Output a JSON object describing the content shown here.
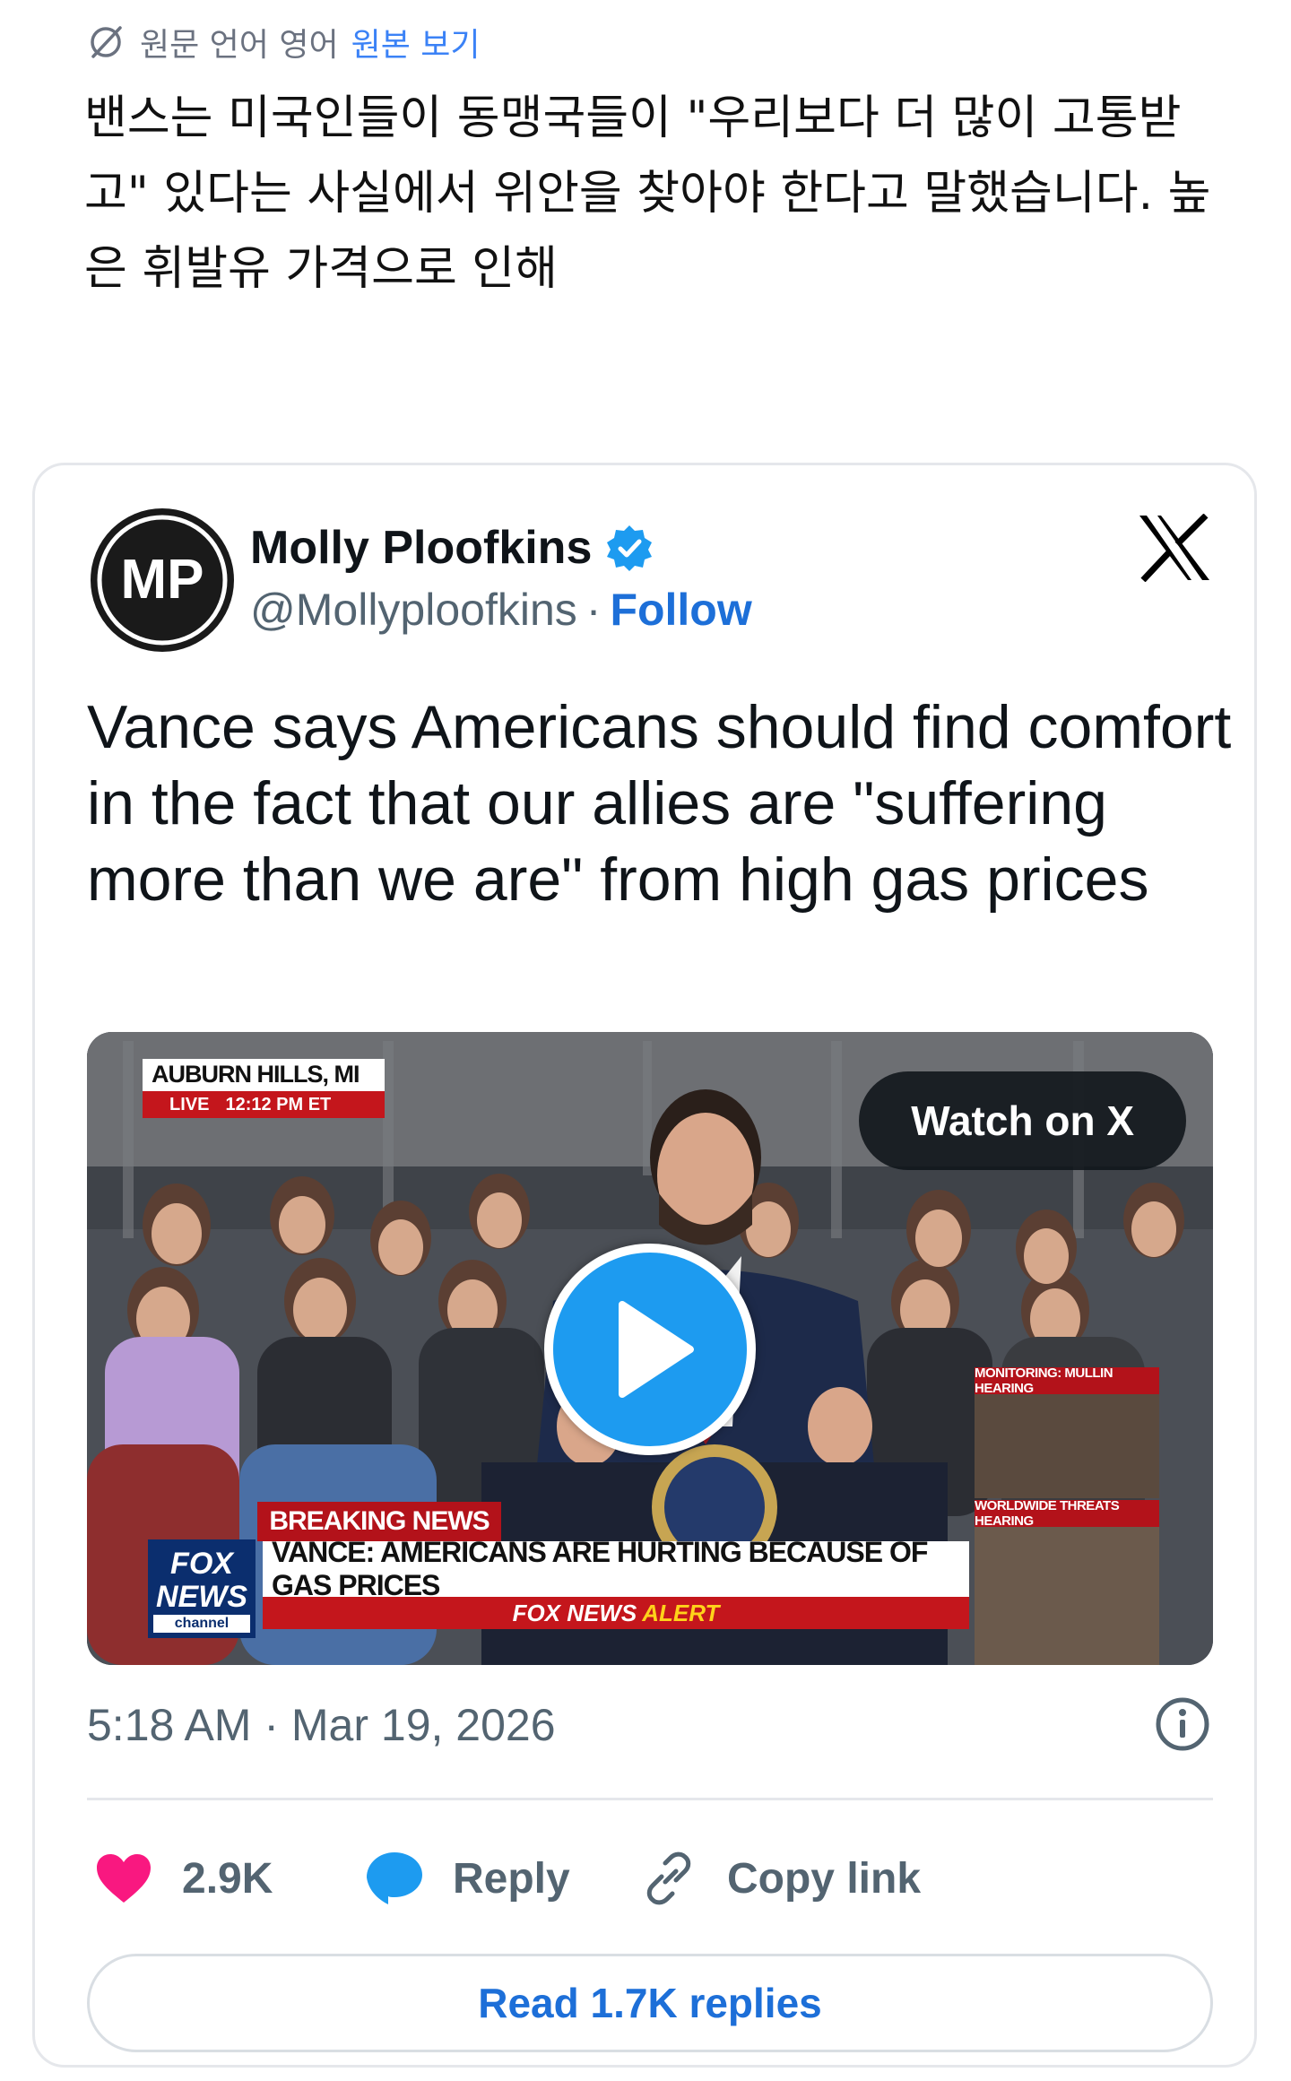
{
  "translation": {
    "source_language_label": "원문 언어 영어",
    "view_original_label": "원본 보기",
    "text": "밴스는 미국인들이 동맹국들이 \"우리보다 더 많이 고통받고\" 있다는 사실에서 위안을 찾아야 한다고 말했습니다. 높은 휘발유 가격으로 인해"
  },
  "tweet": {
    "author_name": "Molly Ploofkins",
    "avatar_initials": "MP",
    "handle": "@Mollyploofkins",
    "separator": "·",
    "follow_label": "Follow",
    "text": "Vance says Americans should find comfort in the fact that our allies are \"suffering more than we are\" from high gas prices",
    "timestamp": "5:18 AM · Mar 19, 2026",
    "likes": "2.9K",
    "reply_label": "Reply",
    "copy_link_label": "Copy link",
    "read_replies_label": "Read 1.7K replies"
  },
  "video": {
    "watch_label": "Watch on X",
    "location": "AUBURN HILLS, MI",
    "live_label": "LIVE",
    "live_time": "12:12 PM ET",
    "breaking_label": "BREAKING NEWS",
    "headline": "VANCE: AMERICANS ARE HURTING BECAUSE OF GAS PRICES",
    "alert_prefix": "FOX NEWS",
    "alert_suffix": "ALERT",
    "network_line1": "FOX",
    "network_line2": "NEWS",
    "network_line3": "channel",
    "side_label_1": "MONITORING: MULLIN HEARING",
    "side_label_2": "WORLDWIDE THREATS HEARING"
  },
  "colors": {
    "accent": "#1d9bf0",
    "link": "#1d6fd8",
    "like": "#f91880",
    "fox_red": "#c4161c"
  }
}
